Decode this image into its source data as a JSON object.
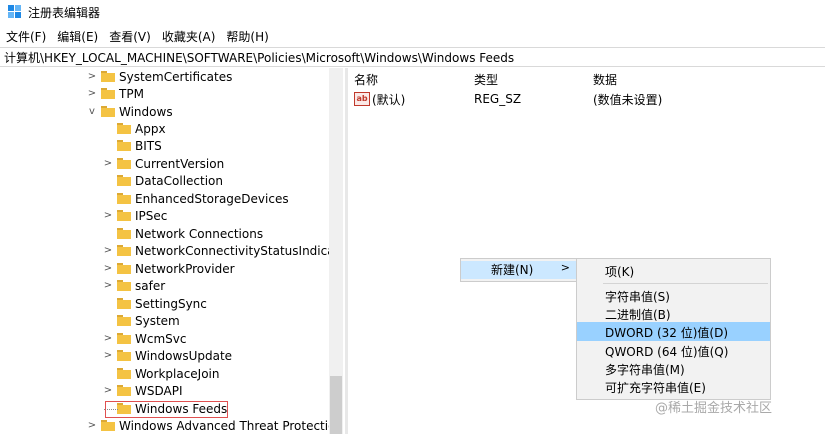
{
  "window": {
    "title": "注册表编辑器"
  },
  "menu": [
    "文件(F)",
    "编辑(E)",
    "查看(V)",
    "收藏夹(A)",
    "帮助(H)"
  ],
  "address": "计算机\\HKEY_LOCAL_MACHINE\\SOFTWARE\\Policies\\Microsoft\\Windows\\Windows Feeds",
  "tree": [
    {
      "label": "SystemCertificates",
      "chevron": ">"
    },
    {
      "label": "TPM",
      "chevron": ">"
    },
    {
      "label": "Windows",
      "chevron": "v"
    },
    {
      "label": "Appx",
      "chevron": ""
    },
    {
      "label": "BITS",
      "chevron": ""
    },
    {
      "label": "CurrentVersion",
      "chevron": ">"
    },
    {
      "label": "DataCollection",
      "chevron": ""
    },
    {
      "label": "EnhancedStorageDevices",
      "chevron": ""
    },
    {
      "label": "IPSec",
      "chevron": ">"
    },
    {
      "label": "Network Connections",
      "chevron": ""
    },
    {
      "label": "NetworkConnectivityStatusIndica",
      "chevron": ">"
    },
    {
      "label": "NetworkProvider",
      "chevron": ">"
    },
    {
      "label": "safer",
      "chevron": ">"
    },
    {
      "label": "SettingSync",
      "chevron": ""
    },
    {
      "label": "System",
      "chevron": ""
    },
    {
      "label": "WcmSvc",
      "chevron": ">"
    },
    {
      "label": "WindowsUpdate",
      "chevron": ">"
    },
    {
      "label": "WorkplaceJoin",
      "chevron": ""
    },
    {
      "label": "WSDAPI",
      "chevron": ">"
    },
    {
      "label": "Windows Feeds",
      "chevron": ""
    },
    {
      "label": "Windows Advanced Threat Protectio",
      "chevron": ">"
    }
  ],
  "columns": {
    "name": "名称",
    "type": "类型",
    "data": "数据"
  },
  "values": [
    {
      "icon": "ab",
      "name": "(默认)",
      "type": "REG_SZ",
      "data": "(数值未设置)"
    }
  ],
  "context_menu": {
    "new_label": "新建(N)",
    "arrow": ">"
  },
  "submenu": [
    "项(K)",
    "字符串值(S)",
    "二进制值(B)",
    "DWORD (32 位)值(D)",
    "QWORD (64 位)值(Q)",
    "多字符串值(M)",
    "可扩充字符串值(E)"
  ],
  "watermark": "@稀土掘金技术社区"
}
